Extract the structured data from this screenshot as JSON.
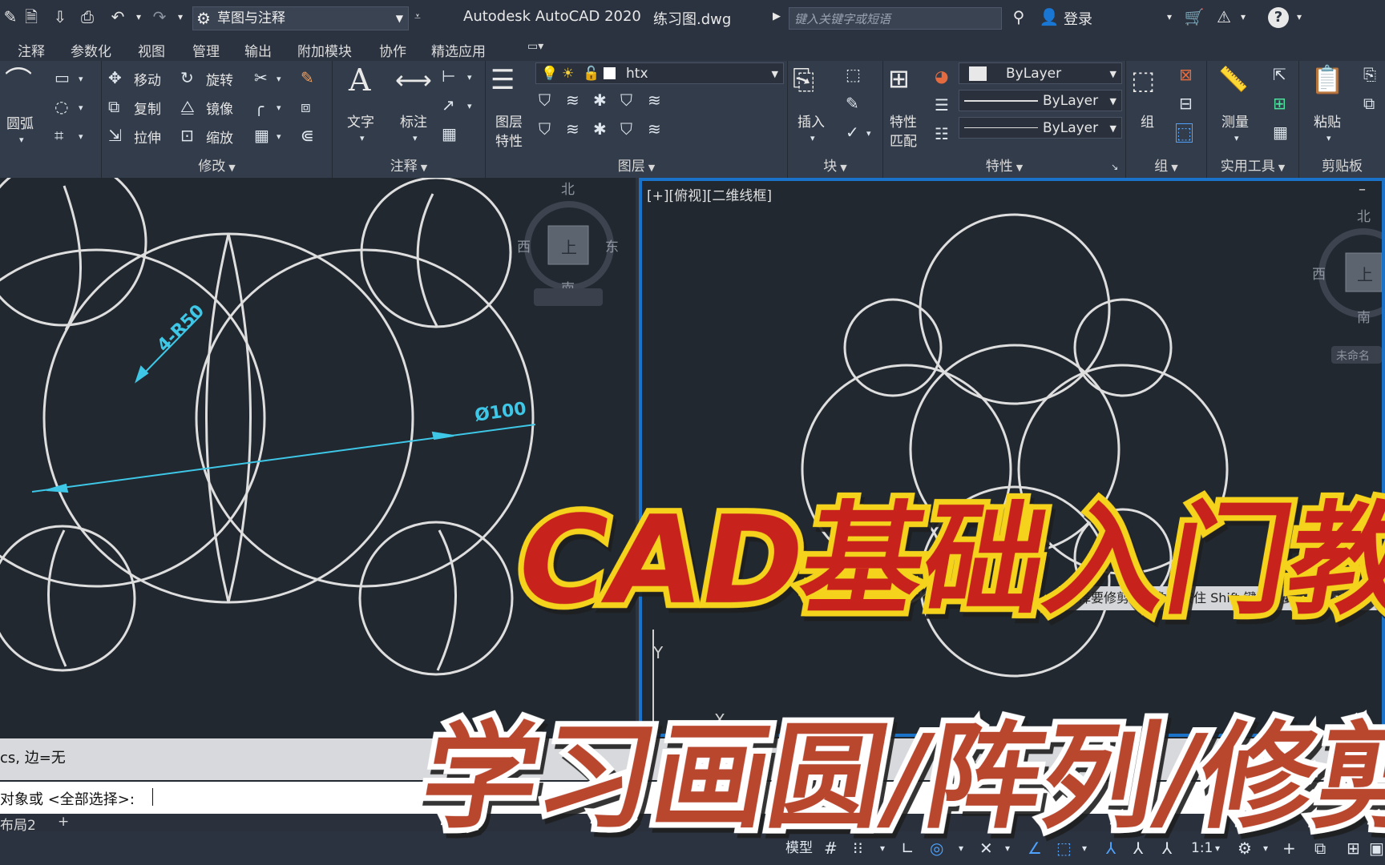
{
  "title_bar": {
    "workspace": "草图与注释",
    "app_title": "Autodesk AutoCAD 2020",
    "file_name": "练习图.dwg",
    "search_placeholder": "键入关键字或短语",
    "login": "登录"
  },
  "menu": [
    "注释",
    "参数化",
    "视图",
    "管理",
    "输出",
    "附加模块",
    "协作",
    "精选应用"
  ],
  "ribbon": {
    "draw": {
      "arc": "圆弧"
    },
    "modify": {
      "title": "修改",
      "move": "移动",
      "rotate": "旋转",
      "copy": "复制",
      "mirror": "镜像",
      "stretch": "拉伸",
      "scale": "缩放"
    },
    "annotation": {
      "title": "注释",
      "text": "文字",
      "dimension": "标注"
    },
    "layers": {
      "title": "图层",
      "layer_props_line1": "图层",
      "layer_props_line2": "特性",
      "current_layer": "htx"
    },
    "block": {
      "title": "块",
      "insert": "插入"
    },
    "properties": {
      "title": "特性",
      "match_line1": "特性",
      "match_line2": "匹配",
      "color": "ByLayer",
      "linetype": "ByLayer",
      "lineweight": "ByLayer"
    },
    "groups": {
      "title": "组",
      "group": "组"
    },
    "utilities": {
      "title": "实用工具",
      "measure": "测量"
    },
    "clipboard": {
      "title": "剪贴板",
      "paste": "粘贴"
    }
  },
  "left_viewport": {
    "compass": {
      "north": "北",
      "south": "南",
      "east": "东",
      "west": "西",
      "face": "上"
    },
    "dim_radius": "4-R50",
    "dim_diameter": "Ø100"
  },
  "right_viewport": {
    "label": "[+][俯视][二维线框]",
    "compass": {
      "north": "北",
      "south": "南",
      "west": "西",
      "face": "上"
    },
    "wcs_menu": "未命名",
    "tooltip": "选择要修剪的对象或按住 Shift 键选择要延伸的对象",
    "ucs_y": "Y",
    "ucs_x": "X"
  },
  "command": {
    "history": "cs, 边=无",
    "prompt": "对象或 <全部选择>:"
  },
  "layout_tabs": {
    "layout2": "布局2",
    "add": "+"
  },
  "status_bar": {
    "model": "模型",
    "scale": "1:1"
  },
  "overlay": {
    "headline": "CAD基础入门教程",
    "subline": "学习画圆/阵列/修剪"
  },
  "colors": {
    "accent_blue": "#1a73c9",
    "dimension_cyan": "#3ec7e6",
    "headline_red": "#c8201e",
    "headline_yellow": "#f5d31a",
    "subline_rust": "#b9472f",
    "subline_teal": "#0d7a8e"
  }
}
